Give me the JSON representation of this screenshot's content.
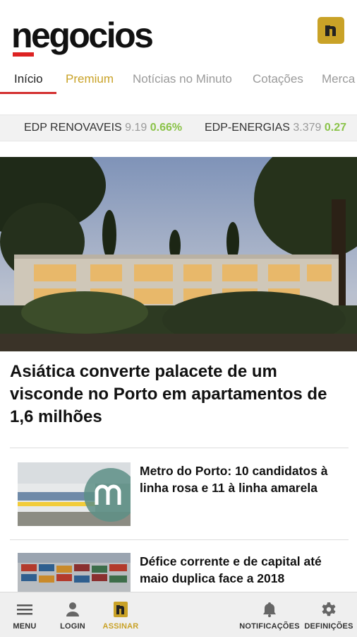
{
  "header": {
    "logo_text": "negocios",
    "app_badge_letter": "n"
  },
  "tabs": [
    {
      "label": "Início",
      "active": true
    },
    {
      "label": "Premium",
      "color": "#c9a227"
    },
    {
      "label": "Notícias no Minuto"
    },
    {
      "label": "Cotações"
    },
    {
      "label": "Merca"
    }
  ],
  "ticker": [
    {
      "name": "EDP RENOVAVEIS",
      "value": "9.19",
      "change": "0.66%"
    },
    {
      "name": "EDP-ENERGIAS",
      "value": "3.379",
      "change": "0.27"
    }
  ],
  "main": {
    "headline": "Asiática converte palacete de um visconde no Porto em apartamentos de 1,6 milhões",
    "news": [
      {
        "title": "Metro do Porto: 10 candidatos à linha rosa e 11 à linha amarela"
      },
      {
        "title": "Défice corrente e de capital até maio duplica face a 2018"
      }
    ]
  },
  "bottom_nav": [
    {
      "label": "MENU",
      "icon": "menu-icon"
    },
    {
      "label": "LOGIN",
      "icon": "user-icon"
    },
    {
      "label": "ASSINAR",
      "icon": "subscribe-icon"
    },
    {
      "label": "NOTIFICAÇÕES",
      "icon": "bell-icon"
    },
    {
      "label": "DEFINIÇÕES",
      "icon": "gear-icon"
    }
  ],
  "colors": {
    "accent_gold": "#c9a227",
    "tab_underline": "#d32f2f",
    "positive_change": "#8bc34a"
  }
}
